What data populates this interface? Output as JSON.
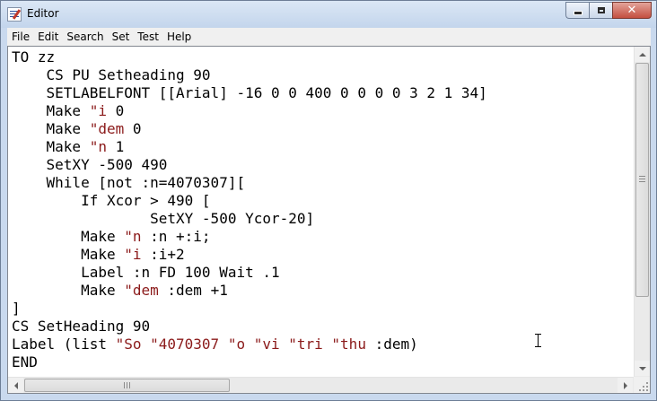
{
  "window": {
    "title": "Editor",
    "close_glyph": "✕"
  },
  "menu": [
    "File",
    "Edit",
    "Search",
    "Set",
    "Test",
    "Help"
  ],
  "editor": {
    "lines": [
      {
        "indent": "",
        "text": "TO zz",
        "str": "",
        "tail": ""
      },
      {
        "indent": "    ",
        "text": "CS PU Setheading 90",
        "str": "",
        "tail": ""
      },
      {
        "indent": "    ",
        "text": "SETLABELFONT [[Arial] -16 0 0 400 0 0 0 0 3 2 1 34]",
        "str": "",
        "tail": ""
      },
      {
        "indent": "    ",
        "text": "Make ",
        "str": "\"i",
        "tail": " 0"
      },
      {
        "indent": "    ",
        "text": "Make ",
        "str": "\"dem",
        "tail": " 0"
      },
      {
        "indent": "    ",
        "text": "Make ",
        "str": "\"n",
        "tail": " 1"
      },
      {
        "indent": "    ",
        "text": "SetXY -500 490",
        "str": "",
        "tail": ""
      },
      {
        "indent": "    ",
        "text": "While [not :n=4070307][",
        "str": "",
        "tail": ""
      },
      {
        "indent": "        ",
        "text": "If Xcor > 490 [",
        "str": "",
        "tail": ""
      },
      {
        "indent": "                ",
        "text": "SetXY -500 Ycor-20]",
        "str": "",
        "tail": ""
      },
      {
        "indent": "        ",
        "text": "Make ",
        "str": "\"n",
        "tail": " :n +:i;"
      },
      {
        "indent": "        ",
        "text": "Make ",
        "str": "\"i",
        "tail": " :i+2"
      },
      {
        "indent": "        ",
        "text": "Label :n FD 100 Wait .1",
        "str": "",
        "tail": ""
      },
      {
        "indent": "        ",
        "text": "Make ",
        "str": "\"dem",
        "tail": " :dem +1"
      },
      {
        "indent": "",
        "text": "]",
        "str": "",
        "tail": ""
      },
      {
        "indent": "",
        "text": "CS SetHeading 90",
        "str": "",
        "tail": ""
      },
      {
        "indent": "",
        "text": "Label (list ",
        "str": "\"So \"4070307 \"o \"vi \"tri \"thu",
        "tail": " :dem)"
      },
      {
        "indent": "",
        "text": "END",
        "str": "",
        "tail": ""
      }
    ],
    "colors": {
      "text": "#000000",
      "quoted_word": "#8b1a1a"
    }
  },
  "scrollbars": {
    "vertical_position": 0.0,
    "horizontal_position": 0.0
  }
}
